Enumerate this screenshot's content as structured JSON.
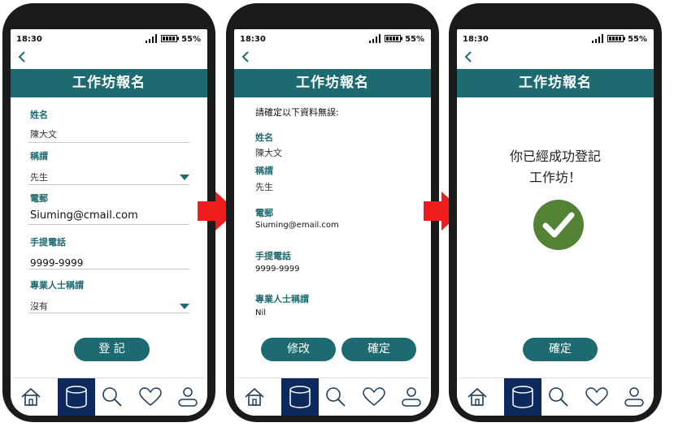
{
  "status": {
    "time": "18:30",
    "battery": "55%"
  },
  "header": {
    "title": "工作坊報名"
  },
  "form": {
    "name_label": "姓名",
    "name_value": "陳大文",
    "title_label": "稱謂",
    "title_value": "先生",
    "email_label": "電郵",
    "email_value": "Siuming@cmail.com",
    "phone_label": "手提電話",
    "phone_value": "9999-9999",
    "prof_label": "專業人士稱謂",
    "prof_value": "沒有",
    "submit_label": "登 記"
  },
  "confirm": {
    "intro": "請確定以下資料無誤:",
    "name_label": "姓名",
    "name_value": "陳大文",
    "title_label": "稱謂",
    "title_value": "先生",
    "email_label": "電郵",
    "email_value": "Siuming@email.com",
    "phone_label": "手提電話",
    "phone_value": "9999-9999",
    "prof_label": "專業人士稱謂",
    "prof_value": "Nil",
    "edit_label": "修改",
    "confirm_label": "確定"
  },
  "success": {
    "line1": "你已經成功登記",
    "line2": "工作坊！",
    "confirm_label": "確定"
  },
  "nav": {
    "items": [
      "home-icon",
      "database-icon",
      "search-icon",
      "heart-icon",
      "user-icon"
    ]
  },
  "colors": {
    "accent": "#1d6a70",
    "nav_active": "#0e2a5c",
    "arrow": "#ee1c1c",
    "success": "#548235"
  }
}
